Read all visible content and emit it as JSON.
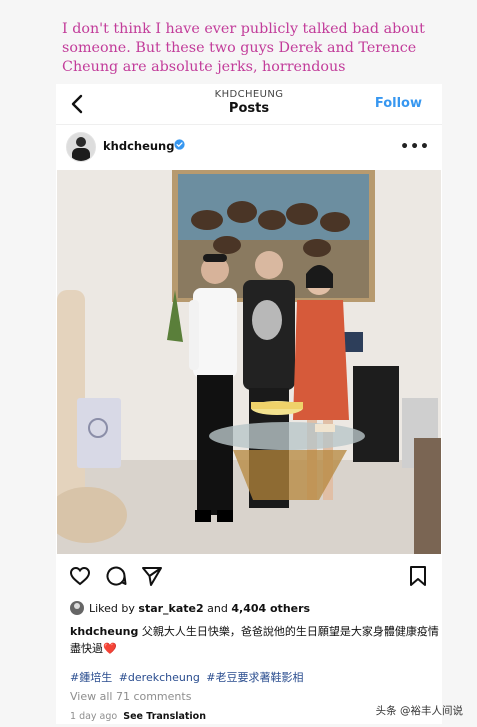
{
  "caption_text": "I don't think I have ever publicly talked bad about someone. But these two guys Derek and Terence Cheung are absolute jerks, horrendous",
  "header": {
    "account": "KHDCHEUNG",
    "title": "Posts",
    "follow_label": "Follow",
    "icons": {
      "back": "chevron-left-icon"
    }
  },
  "post": {
    "username": "khdcheung",
    "icons": {
      "verified": "verified-badge-icon",
      "more": "more-options-icon"
    },
    "colors": {
      "verified": "#3797f0",
      "follow": "#3797f0",
      "hashtag": "#2a4d8f",
      "caption_overlay": "#c23c9a"
    },
    "likes": {
      "prefix": "Liked by",
      "user": "star_kate2",
      "and": "and",
      "count": "4,404 others"
    },
    "caption": {
      "username": "khdcheung",
      "text": "父親大人生日快樂，爸爸說他的生日願望是大家身體健康疫情盡快過",
      "emoji": "❤️"
    },
    "hashtags": "#鍾培生 #derekcheung #老豆要求著鞋影相",
    "view_comments": "View all 71 comments",
    "time": "1 day ago",
    "see_translation": "See Translation"
  },
  "watermark": "头条 @裕丰人间说"
}
